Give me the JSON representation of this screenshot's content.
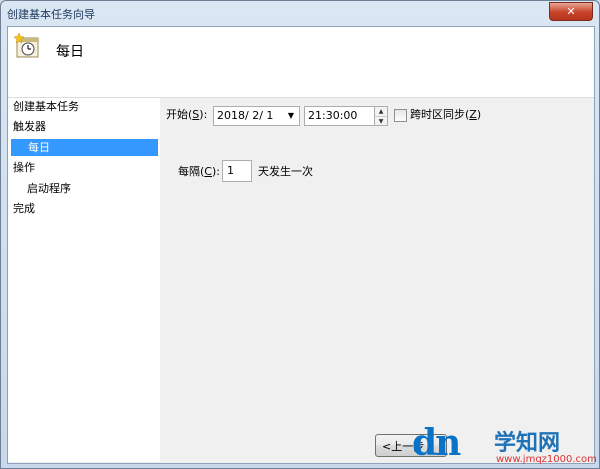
{
  "window": {
    "title": "创建基本任务向导",
    "close_glyph": "✕"
  },
  "header": {
    "title": "每日",
    "icon": "clock-task-icon"
  },
  "sidebar": {
    "items": [
      {
        "label": "创建基本任务",
        "indent": false,
        "selected": false
      },
      {
        "label": "触发器",
        "indent": false,
        "selected": false
      },
      {
        "label": "每日",
        "indent": true,
        "selected": true
      },
      {
        "label": "操作",
        "indent": false,
        "selected": false
      },
      {
        "label": "启动程序",
        "indent": true,
        "selected": false
      },
      {
        "label": "完成",
        "indent": false,
        "selected": false
      }
    ]
  },
  "form": {
    "start_label": "开始(",
    "start_hotkey": "S",
    "start_suffix": "):",
    "date_value": "2018/  2/  1",
    "time_value": "21:30:00",
    "sync_label": "跨时区同步(",
    "sync_hotkey": "Z",
    "sync_suffix": ")",
    "sync_checked": false,
    "every_label": "每隔(",
    "every_hotkey": "C",
    "every_suffix": "):",
    "every_value": "1",
    "every_unit": "天发生一次"
  },
  "footer": {
    "back_label": "<上一步"
  },
  "watermark": {
    "logo": "dn",
    "title": "学知网",
    "url": "www.jmqz1000.com"
  },
  "colors": {
    "selected": "#3399ff",
    "window_frame": "#c9d8ea"
  }
}
